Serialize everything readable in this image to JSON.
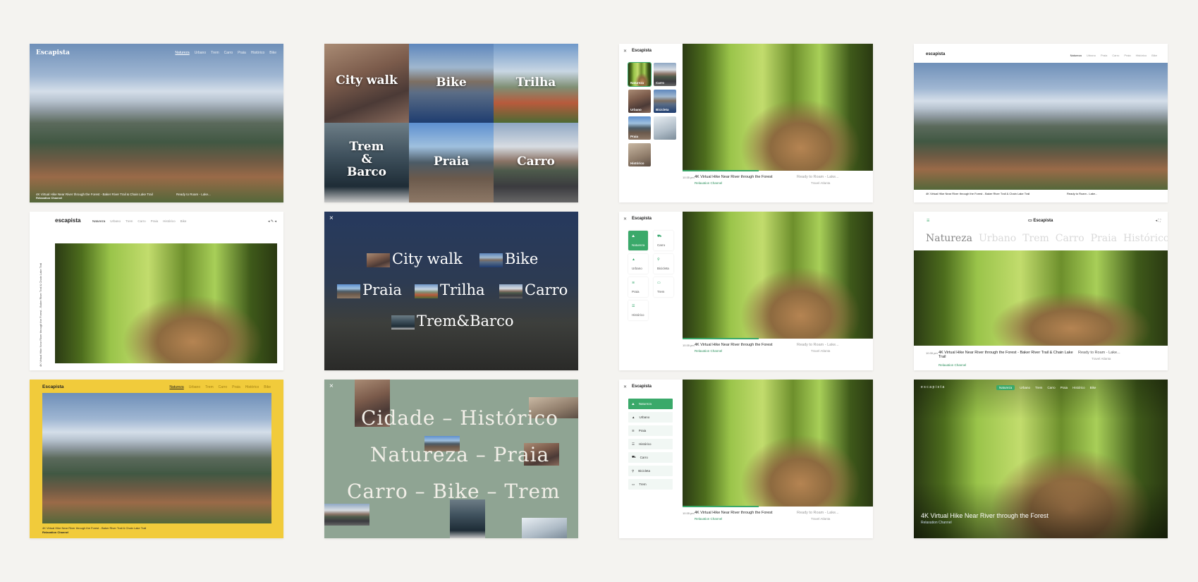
{
  "brand": "Escapista",
  "brand_lower": "escapista",
  "categories": [
    "Natureza",
    "Urbano",
    "Trem",
    "Carro",
    "Praia",
    "Histórico",
    "Bike"
  ],
  "grid_labels": [
    "City walk",
    "Bike",
    "Trilha",
    "Trem & Barco",
    "Praia",
    "Carro"
  ],
  "side_labels": [
    "Natureza",
    "Carro",
    "Urbano",
    "Bicicleta",
    "Praia",
    "Trem",
    "Histórico"
  ],
  "word_labels": [
    "City walk",
    "Bike",
    "Praia",
    "Trilha",
    "Carro",
    "Trem&Barco"
  ],
  "big_lines": [
    "Cidade – Histórico",
    "Natureza – Praia",
    "Carro – Bike – Trem"
  ],
  "video": {
    "time": "10:35 pm",
    "title": "4K Virtual Hike Near River through the Forest",
    "channel": "Relaxation Channel",
    "next_time": "10:48 pm",
    "next_title": "Ready to Roam - Lake...",
    "next_channel": "Travel Atlanta",
    "long_title": "4K Virtual Hike Near River through the Forest - Baker River Trail & Chain Lake Trail",
    "short_caption": "4K Virtual Hike Near River through the Forest - Baker River Trail & Chain Lake Trail"
  },
  "hero_caption": "4K Virtual Hike Near River through the Forest - Baker River Trail & Chain Lake Trail",
  "colors": {
    "bg": "#f4f3f0",
    "green": "#3aa96a",
    "yellow": "#f1cb3b",
    "sage": "#8fa493",
    "navy": "#1f2a44"
  }
}
